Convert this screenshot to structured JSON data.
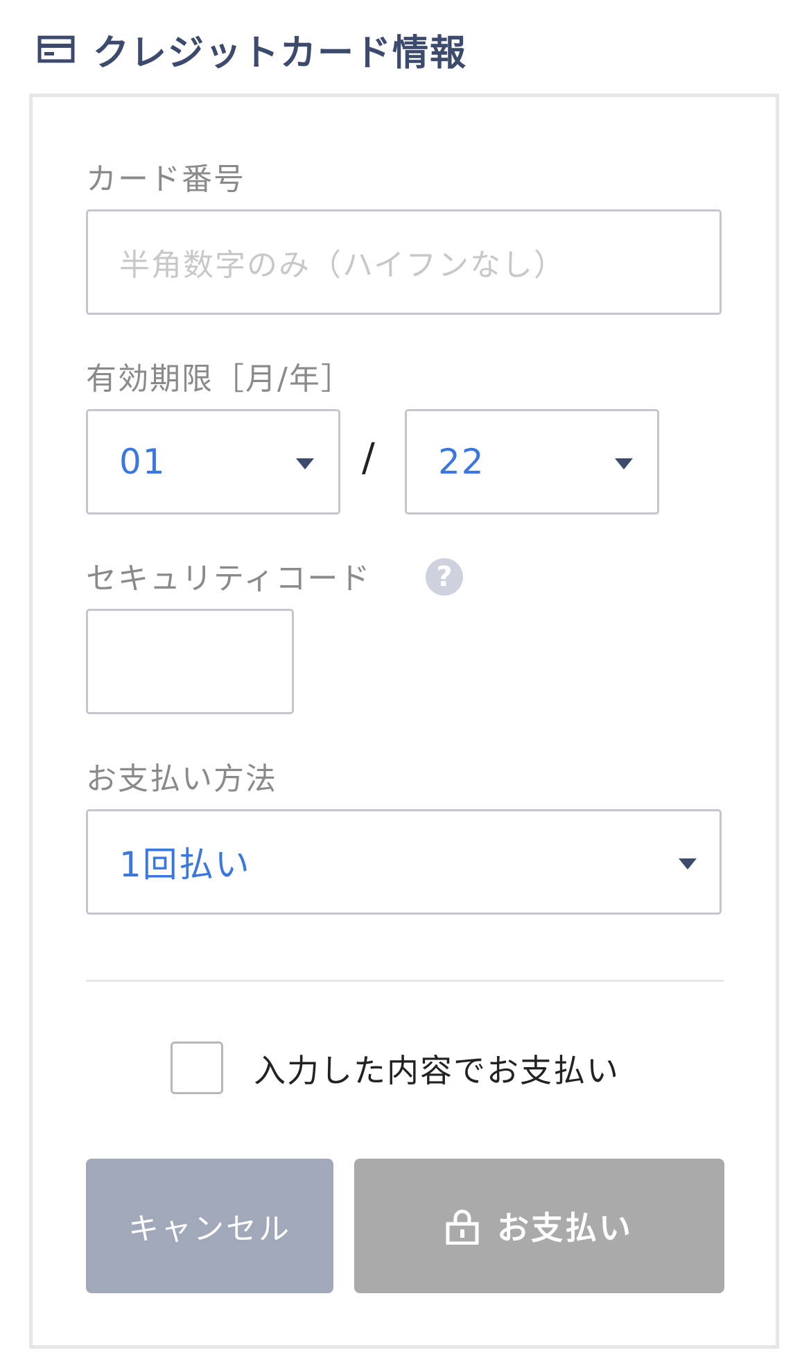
{
  "header": {
    "icon": "credit-card-icon",
    "title": "クレジットカード情報"
  },
  "card_number": {
    "label": "カード番号",
    "placeholder": "半角数字のみ（ハイフンなし）",
    "value": ""
  },
  "expiry": {
    "label": "有効期限［月/年］",
    "month": "01",
    "separator": "/",
    "year": "22"
  },
  "security_code": {
    "label": "セキュリティコード",
    "help_icon": "help-icon",
    "help_glyph": "?",
    "value": ""
  },
  "payment_method": {
    "label": "お支払い方法",
    "selected": "1回払い"
  },
  "confirm": {
    "label": "入力した内容でお支払い",
    "checked": false
  },
  "buttons": {
    "cancel": "キャンセル",
    "pay": "お支払い",
    "pay_icon": "lock-icon"
  },
  "colors": {
    "title": "#3c4a6e",
    "selected_value": "#3a78e0",
    "cancel_button": "#a0a8ba",
    "pay_button_disabled": "#aaaaaa"
  }
}
